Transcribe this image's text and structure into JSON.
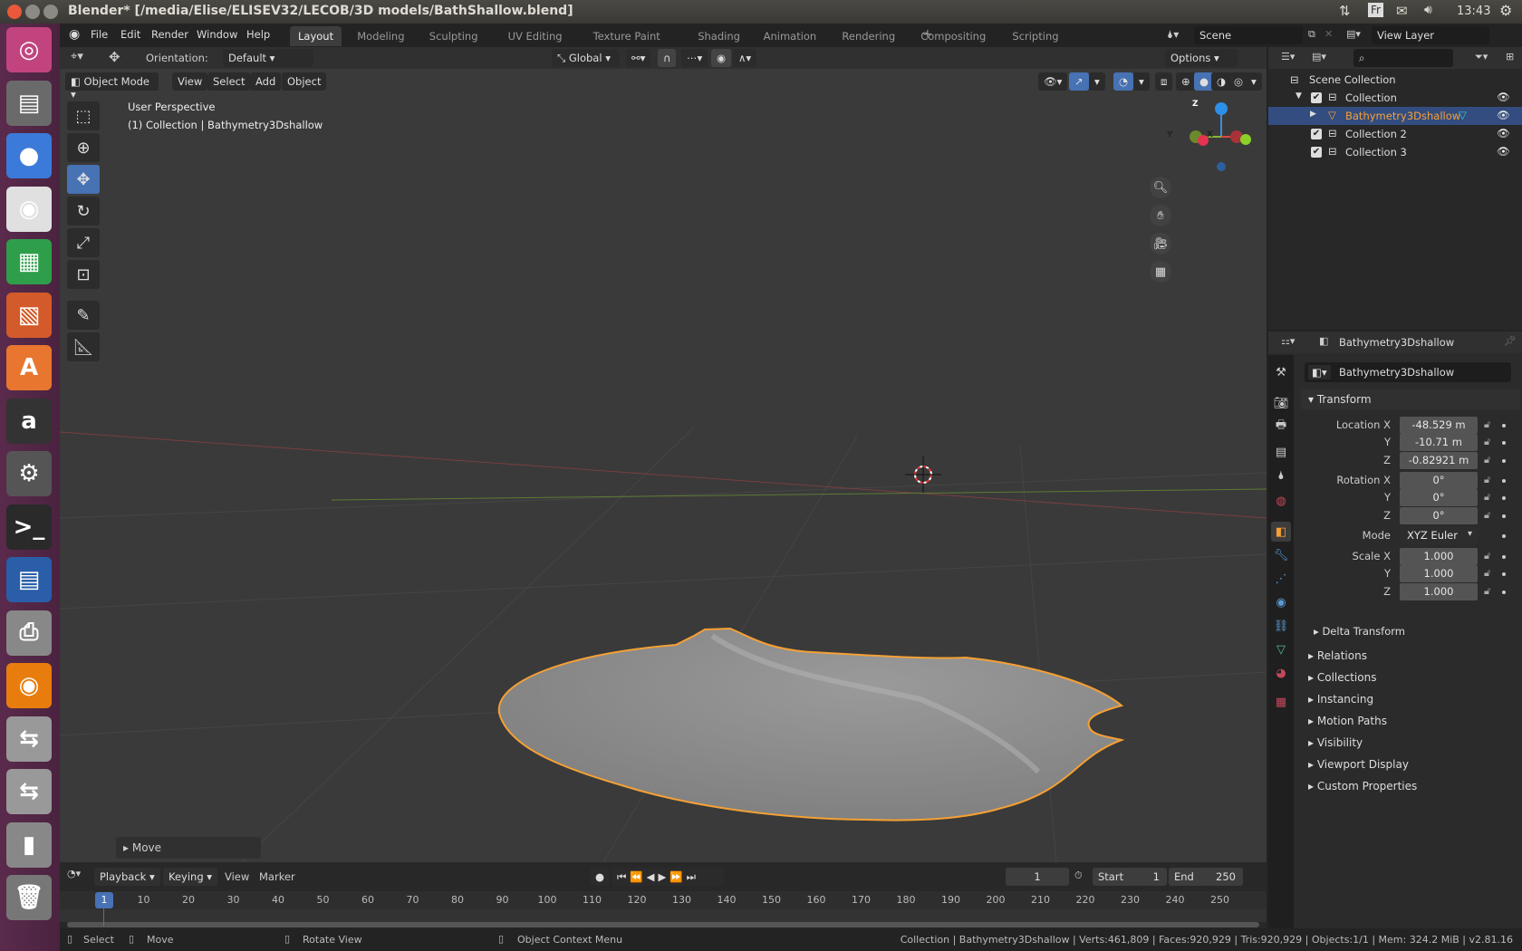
{
  "os": {
    "title": "Blender* [/media/Elise/ELISEV32/LECOB/3D models/BathShallow.blend]",
    "lang": "Fr",
    "clock": "13:43"
  },
  "launcher": [
    {
      "icon": "ubuntu-icon"
    },
    {
      "icon": "files-icon"
    },
    {
      "icon": "chromium-icon"
    },
    {
      "icon": "chrome-icon"
    },
    {
      "icon": "spreadsheet-icon"
    },
    {
      "icon": "presentation-icon"
    },
    {
      "icon": "software-center-icon"
    },
    {
      "icon": "amazon-icon"
    },
    {
      "icon": "settings-icon"
    },
    {
      "icon": "terminal-icon"
    },
    {
      "icon": "writer-icon"
    },
    {
      "icon": "scanner-icon"
    },
    {
      "icon": "blender-icon"
    },
    {
      "icon": "usb-drive-icon"
    },
    {
      "icon": "usb-drive-icon"
    },
    {
      "icon": "usb-stick-icon"
    },
    {
      "icon": "trash-icon"
    }
  ],
  "menus": [
    "File",
    "Edit",
    "Render",
    "Window",
    "Help"
  ],
  "workspaces": [
    "Layout",
    "Modeling",
    "Sculpting",
    "UV Editing",
    "Texture Paint",
    "Shading",
    "Animation",
    "Rendering",
    "Compositing",
    "Scripting"
  ],
  "active_workspace": "Layout",
  "scene": "Scene",
  "view_layer": "View Layer",
  "tool_header": {
    "orientation_label": "Orientation:",
    "orientation": "Default",
    "transform": "Global",
    "options": "Options"
  },
  "view_header": {
    "mode": "Object Mode",
    "menus": [
      "View",
      "Select",
      "Add",
      "Object"
    ]
  },
  "viewport": {
    "perspective": "User Perspective",
    "context": "(1) Collection | Bathymetry3Dshallow",
    "gizmo": {
      "z": "Z",
      "y": "Y",
      "x": "X"
    },
    "last_op": "Move"
  },
  "outliner": {
    "root": "Scene Collection",
    "items": [
      {
        "name": "Collection",
        "level": 1
      },
      {
        "name": "Bathymetry3Dshallow",
        "level": 2,
        "selected": true
      },
      {
        "name": "Collection 2",
        "level": 1
      },
      {
        "name": "Collection 3",
        "level": 1
      }
    ]
  },
  "properties": {
    "object": "Bathymetry3Dshallow",
    "name_field": "Bathymetry3Dshallow",
    "panel": "Transform",
    "rows": [
      {
        "label": "Location X",
        "value": "-48.529 m"
      },
      {
        "label": "Y",
        "value": "-10.71 m"
      },
      {
        "label": "Z",
        "value": "-0.82921 m"
      },
      {
        "label": "Rotation X",
        "value": "0°"
      },
      {
        "label": "Y",
        "value": "0°"
      },
      {
        "label": "Z",
        "value": "0°"
      },
      {
        "label": "Mode",
        "value": "XYZ Euler"
      },
      {
        "label": "Scale X",
        "value": "1.000"
      },
      {
        "label": "Y",
        "value": "1.000"
      },
      {
        "label": "Z",
        "value": "1.000"
      }
    ],
    "subpanel": "Delta Transform",
    "sections": [
      "Relations",
      "Collections",
      "Instancing",
      "Motion Paths",
      "Visibility",
      "Viewport Display",
      "Custom Properties"
    ]
  },
  "timeline": {
    "menus": [
      "Playback",
      "Keying",
      "View",
      "Marker"
    ],
    "current": "1",
    "start_label": "Start",
    "start": "1",
    "end_label": "End",
    "end": "250",
    "ticks": [
      "10",
      "20",
      "30",
      "40",
      "50",
      "60",
      "70",
      "80",
      "90",
      "100",
      "110",
      "120",
      "130",
      "140",
      "150",
      "160",
      "170",
      "180",
      "190",
      "200",
      "210",
      "220",
      "230",
      "240",
      "250"
    ]
  },
  "status": {
    "select": "Select",
    "move": "Move",
    "rotate": "Rotate View",
    "context": "Object Context Menu",
    "stats": "Collection | Bathymetry3Dshallow | Verts:461,809 | Faces:920,929 | Tris:920,929 | Objects:1/1 | Mem: 324.2 MiB | v2.81.16"
  },
  "colors": {
    "accent": "#4772b3",
    "selection": "#f5a035",
    "selected_row": "#334d80"
  }
}
